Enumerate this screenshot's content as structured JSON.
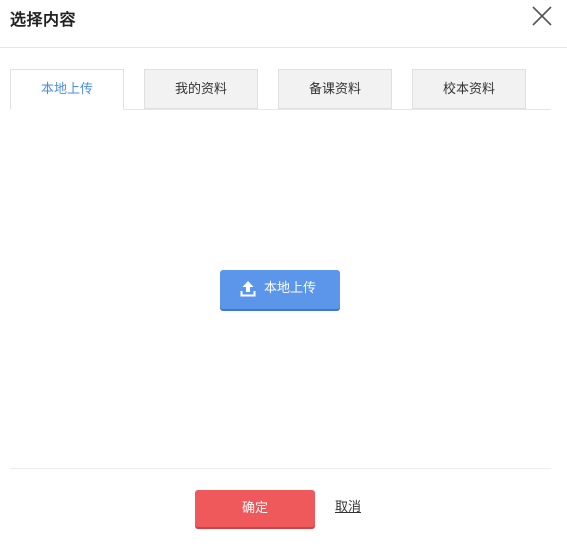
{
  "dialog": {
    "title": "选择内容",
    "close_icon": "close-icon"
  },
  "tabs": [
    {
      "label": "本地上传",
      "active": true
    },
    {
      "label": "我的资料",
      "active": false
    },
    {
      "label": "备课资料",
      "active": false
    },
    {
      "label": "校本资料",
      "active": false
    }
  ],
  "upload": {
    "label": "本地上传",
    "icon": "upload-icon"
  },
  "footer": {
    "confirm_label": "确定",
    "cancel_label": "取消"
  },
  "colors": {
    "accent_blue": "#5b96ea",
    "active_tab_text": "#4b8ee8",
    "confirm_red": "#f0595b"
  }
}
